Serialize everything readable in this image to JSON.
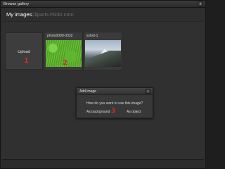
{
  "window": {
    "title": "Browse gallery",
    "close_glyph": "x"
  },
  "tabs": [
    {
      "label": "My images",
      "active": true
    },
    {
      "label": "Cliparts",
      "active": false
    },
    {
      "label": "Flickr.com",
      "active": false
    }
  ],
  "upload": {
    "label": "Upload",
    "marker": "1"
  },
  "images": [
    {
      "caption": "photo0000-0332",
      "marker": "2"
    },
    {
      "caption": "sshot-1"
    }
  ],
  "dialog": {
    "title": "Add image",
    "close_glyph": "x",
    "question": "How do you want to use this image?",
    "button_background": "As background",
    "button_object": "As object",
    "marker": "3"
  },
  "colors": {
    "annotation_marker": "#c92e2e",
    "active_tab": "#ffffff",
    "inactive_tab": "#6d6d6d"
  }
}
